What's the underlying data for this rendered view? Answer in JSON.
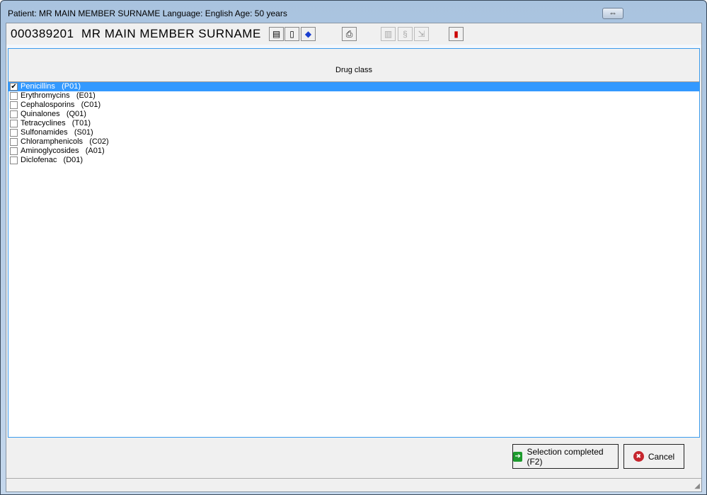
{
  "window": {
    "title": "Patient: MR MAIN MEMBER SURNAME  Language: English Age: 50 years",
    "resize_icon": "⇔"
  },
  "header": {
    "patient_id": "000389201",
    "patient_name": "MR MAIN MEMBER SURNAME"
  },
  "list": {
    "column_header": "Drug class",
    "items": [
      {
        "label": "Penicillins   (P01)",
        "checked": true,
        "selected": true
      },
      {
        "label": "Erythromycins   (E01)",
        "checked": false
      },
      {
        "label": "Cephalosporins   (C01)",
        "checked": false
      },
      {
        "label": "Quinalones   (Q01)",
        "checked": false
      },
      {
        "label": "Tetracyclines   (T01)",
        "checked": false
      },
      {
        "label": "Sulfonamides   (S01)",
        "checked": false
      },
      {
        "label": "Chloramphenicols   (C02)",
        "checked": false
      },
      {
        "label": "Aminoglycosides   (A01)",
        "checked": false
      },
      {
        "label": "Diclofenac   (D01)",
        "checked": false
      }
    ]
  },
  "buttons": {
    "complete": "Selection completed (F2)",
    "cancel": "Cancel"
  },
  "colors": {
    "selection": "#3399ff",
    "accent": "#3c9bec"
  }
}
